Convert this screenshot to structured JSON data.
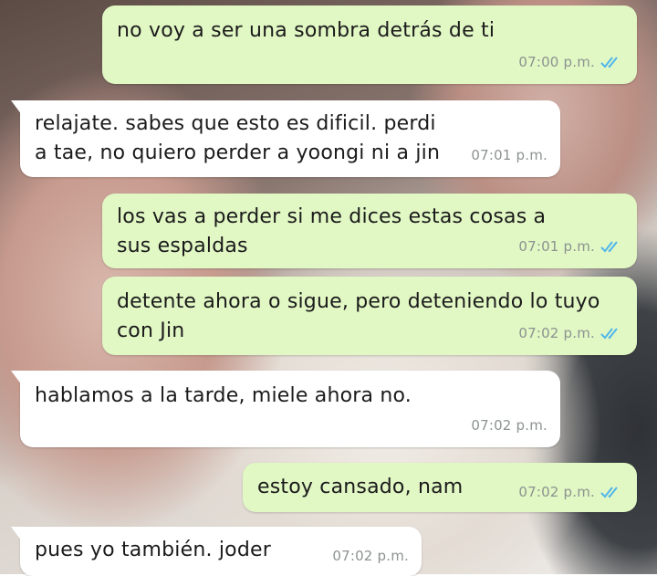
{
  "messages": [
    {
      "direction": "out",
      "text": "no voy a ser una sombra detrás de ti",
      "time": "07:00 p.m.",
      "status": "read"
    },
    {
      "direction": "in",
      "text": "relajate. sabes que esto es dificil. perdi a tae, no quiero perder a yoongi ni a jin",
      "time": "07:01 p.m."
    },
    {
      "direction": "out",
      "text": "los vas a perder si me dices estas cosas a sus espaldas",
      "time": "07:01 p.m.",
      "status": "read"
    },
    {
      "direction": "out",
      "text": "detente ahora o sigue, pero deteniendo lo tuyo con Jin",
      "time": "07:02 p.m.",
      "status": "read"
    },
    {
      "direction": "in",
      "text": "hablamos a la tarde, miele ahora no.",
      "time": "07:02 p.m."
    },
    {
      "direction": "out",
      "text": "estoy cansado, nam",
      "time": "07:02 p.m.",
      "status": "read"
    },
    {
      "direction": "in",
      "text": "pues yo también. joder",
      "time": "07:02 p.m."
    }
  ],
  "colors": {
    "outgoing_bubble": "#e1f7c4",
    "incoming_bubble": "#ffffff",
    "read_ticks": "#4fb6ec",
    "timestamp": "#8c9390"
  },
  "icons": {
    "read_status": "double-check-icon"
  }
}
